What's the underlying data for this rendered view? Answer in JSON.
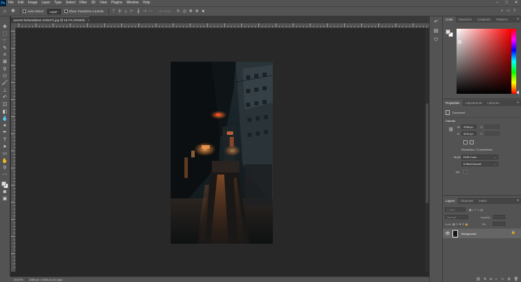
{
  "app": {
    "logo": "Ps"
  },
  "menu": [
    "File",
    "Edit",
    "Image",
    "Layer",
    "Type",
    "Select",
    "Filter",
    "3D",
    "View",
    "Plugins",
    "Window",
    "Help"
  ],
  "window_controls": [
    "–",
    "□",
    "✕"
  ],
  "options": {
    "auto_select_label": "Auto-Select:",
    "auto_select_target": "Layer",
    "transform_label": "Show Transform Controls",
    "mode_3d": "3D Mode:"
  },
  "document": {
    "tab_title": "pexels-furkanalpkan-1109471.jpg @ 16.7% (RGB/8)",
    "close": "×",
    "zoom": "16.67%",
    "info": "2268 px × 4032 px (72 ppi)"
  },
  "color_panel": {
    "tabs": [
      "Color",
      "Swatches",
      "Gradients",
      "Patterns"
    ],
    "foreground": "#e9d9d9",
    "background": "#ffffff"
  },
  "properties": {
    "tabs": [
      "Properties",
      "Adjustments",
      "Libraries"
    ],
    "doc_label": "Document",
    "section_canvas": "Canvas",
    "w_label": "W",
    "w_value": "2268 px",
    "h_label": "H",
    "h_value": "4032 px",
    "x_label": "X",
    "y_label": "Y",
    "resolution": "Resolution: 72 pixels/inch",
    "mode_label": "Mode",
    "mode_value": "RGB Color",
    "bits_value": "8 Bits/Channel",
    "fill_label": "Fill"
  },
  "layers": {
    "tabs": [
      "Layers",
      "Channels",
      "Paths"
    ],
    "kind_label": "Kind",
    "normal_label": "Normal",
    "opacity_label": "Opacity:",
    "lock_label": "Lock:",
    "fill_label": "Fill:",
    "layer_name": "Background"
  }
}
